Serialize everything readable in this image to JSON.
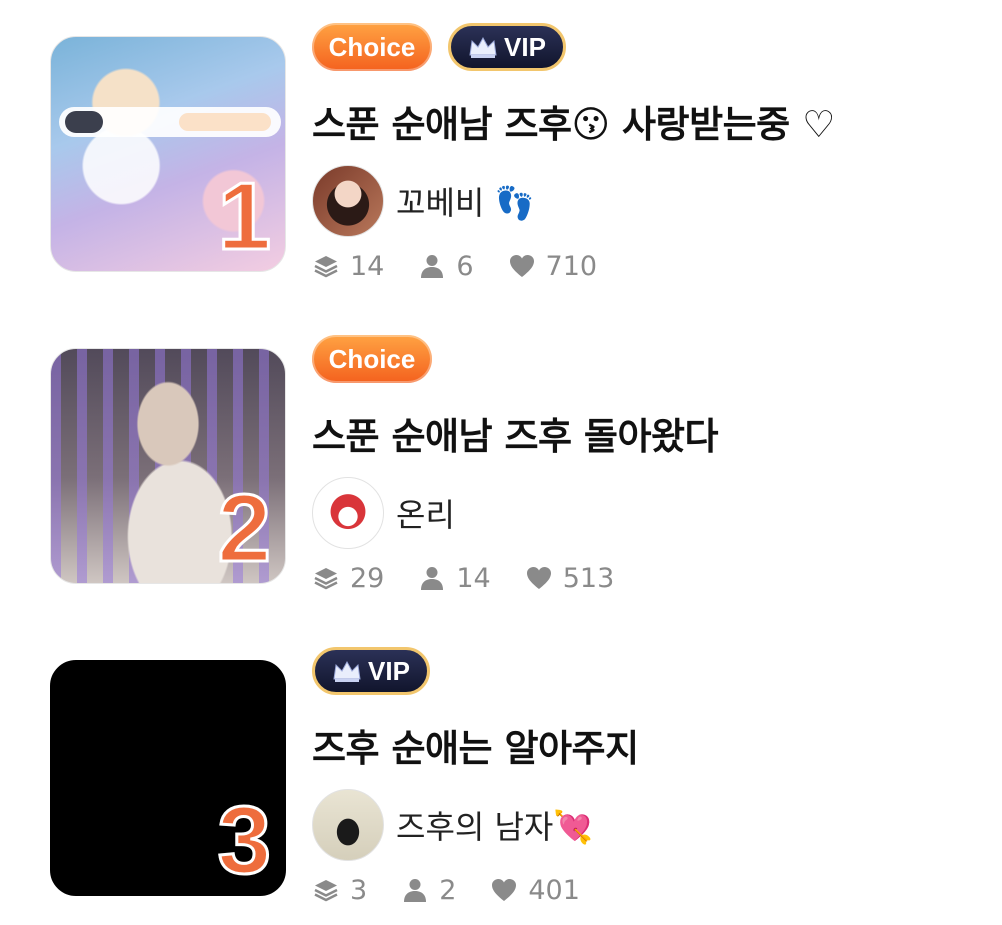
{
  "items": [
    {
      "rank": "1",
      "badges": {
        "choice": "Choice",
        "vip": "VIP"
      },
      "title": "스푼 순애남 즈후😗 사랑받는중 ♡",
      "author": "꼬베비 👣",
      "stats": {
        "layers": "14",
        "users": "6",
        "likes": "710"
      }
    },
    {
      "rank": "2",
      "badges": {
        "choice": "Choice"
      },
      "title": "스푼 순애남 즈후 돌아왔다",
      "author": "온리",
      "stats": {
        "layers": "29",
        "users": "14",
        "likes": "513"
      }
    },
    {
      "rank": "3",
      "badges": {
        "vip": "VIP"
      },
      "title": "즈후 순애는 알아주지",
      "author": "즈후의 남자💘",
      "stats": {
        "layers": "3",
        "users": "2",
        "likes": "401"
      }
    }
  ],
  "colors": {
    "choice_gradient_top": "#ffa343",
    "choice_gradient_bottom": "#f4611e",
    "vip_bg": "#11152d",
    "vip_border": "#f2c66d",
    "rank_number": "#ee6d3d",
    "stat_gray": "#8a8a8a"
  },
  "icons": [
    "layers-icon",
    "user-icon",
    "heart-icon",
    "crown-icon"
  ]
}
